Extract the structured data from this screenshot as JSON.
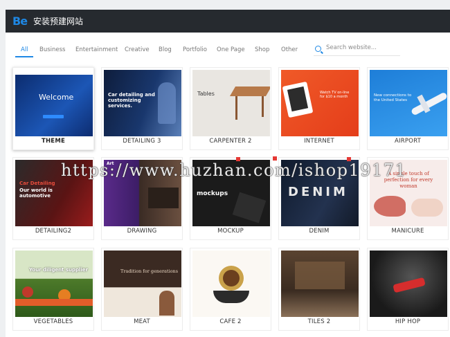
{
  "app": {
    "logo_text": "Be",
    "title": "安装预建网站"
  },
  "filters": {
    "tabs": [
      "All",
      "Business",
      "Entertainment",
      "Creative",
      "Blog",
      "Portfolio",
      "One Page",
      "Shop",
      "Other"
    ],
    "active": "All",
    "search_placeholder": "Search website..."
  },
  "cards": [
    {
      "label": "THEME",
      "selected": true,
      "thumb_text": [
        "Welcome"
      ]
    },
    {
      "label": "DETAILING 3",
      "thumb_text": [
        "Car detailing and customizing services."
      ]
    },
    {
      "label": "CARPENTER 2",
      "thumb_text": [
        "Tables"
      ]
    },
    {
      "label": "INTERNET",
      "thumb_text": [
        "Watch TV on-line for $10 a month"
      ]
    },
    {
      "label": "AIRPORT",
      "thumb_text": [
        "New connections to the United States"
      ]
    },
    {
      "label": "DETAILING2",
      "thumb_text": [
        "Car Detailing",
        "Our world is automotive"
      ]
    },
    {
      "label": "DRAWING",
      "thumb_text": [
        "Art"
      ]
    },
    {
      "label": "MOCKUP",
      "thumb_text": [
        "mockups"
      ]
    },
    {
      "label": "DENIM",
      "thumb_text": [
        "DENIM"
      ]
    },
    {
      "label": "MANICURE",
      "thumb_text": [
        "A single touch of perfection for every woman"
      ]
    },
    {
      "label": "VEGETABLES",
      "thumb_text": [
        "Your diligent supplier"
      ]
    },
    {
      "label": "MEAT",
      "thumb_text": [
        "Tradition for generations"
      ]
    },
    {
      "label": "CAFE 2",
      "thumb_text": []
    },
    {
      "label": "TILES 2",
      "thumb_text": []
    },
    {
      "label": "HIP HOP",
      "thumb_text": []
    }
  ],
  "watermark": "https://www.huzhan.com/ishop19171",
  "colors": {
    "accent": "#1e88e5",
    "header_bg": "#262a2f"
  }
}
